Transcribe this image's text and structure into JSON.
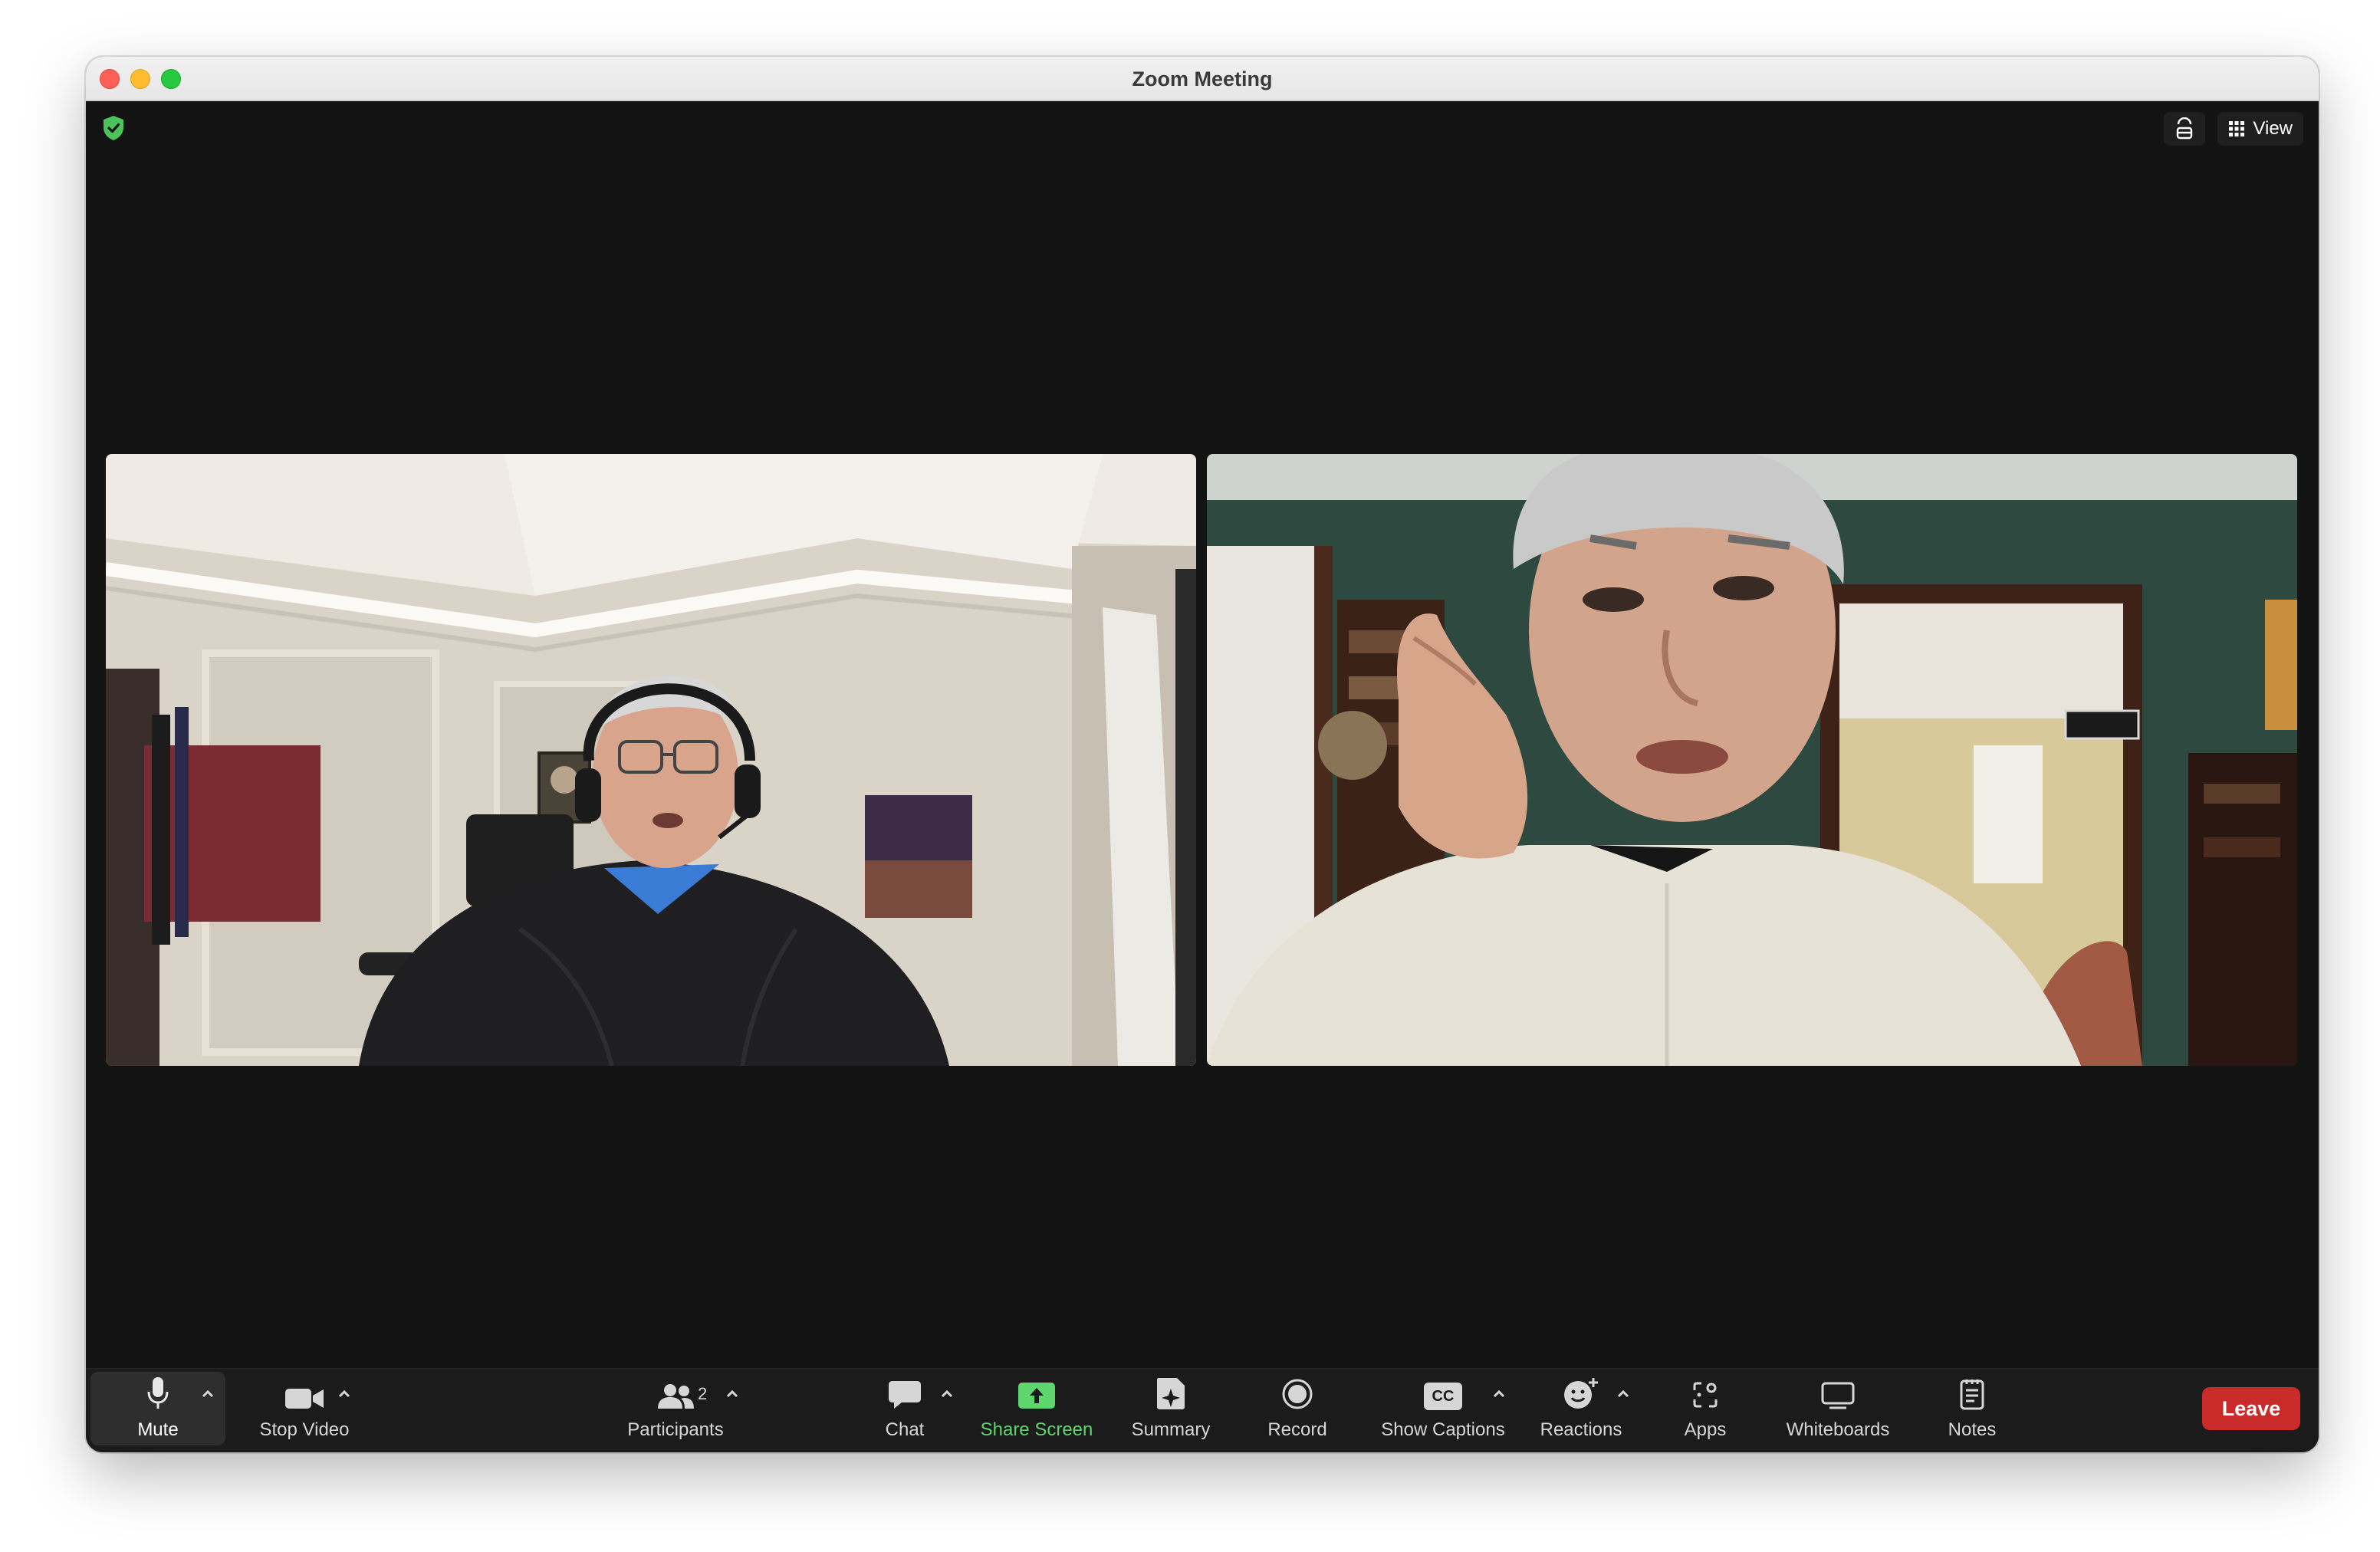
{
  "window": {
    "title": "Zoom Meeting"
  },
  "topbar": {
    "security_icon": "shield-check-icon",
    "security_color": "#4cc35a",
    "immersive_icon": "immersive-view-icon",
    "view_label": "View",
    "view_icon": "grid-icon"
  },
  "participants_video": [
    {
      "name": "participant-video-left",
      "description": "Participant with headset in light room"
    },
    {
      "name": "participant-video-right",
      "description": "Participant resting chin on hand in green room"
    }
  ],
  "toolbar": {
    "mute_label": "Mute",
    "stop_video_label": "Stop Video",
    "participants_label": "Participants",
    "participants_count": "2",
    "chat_label": "Chat",
    "share_screen_label": "Share Screen",
    "share_color": "#5ed56d",
    "summary_label": "Summary",
    "record_label": "Record",
    "captions_label": "Show Captions",
    "captions_icon_text": "CC",
    "reactions_label": "Reactions",
    "apps_label": "Apps",
    "whiteboards_label": "Whiteboards",
    "notes_label": "Notes",
    "leave_label": "Leave",
    "leave_color": "#c92a2a"
  }
}
